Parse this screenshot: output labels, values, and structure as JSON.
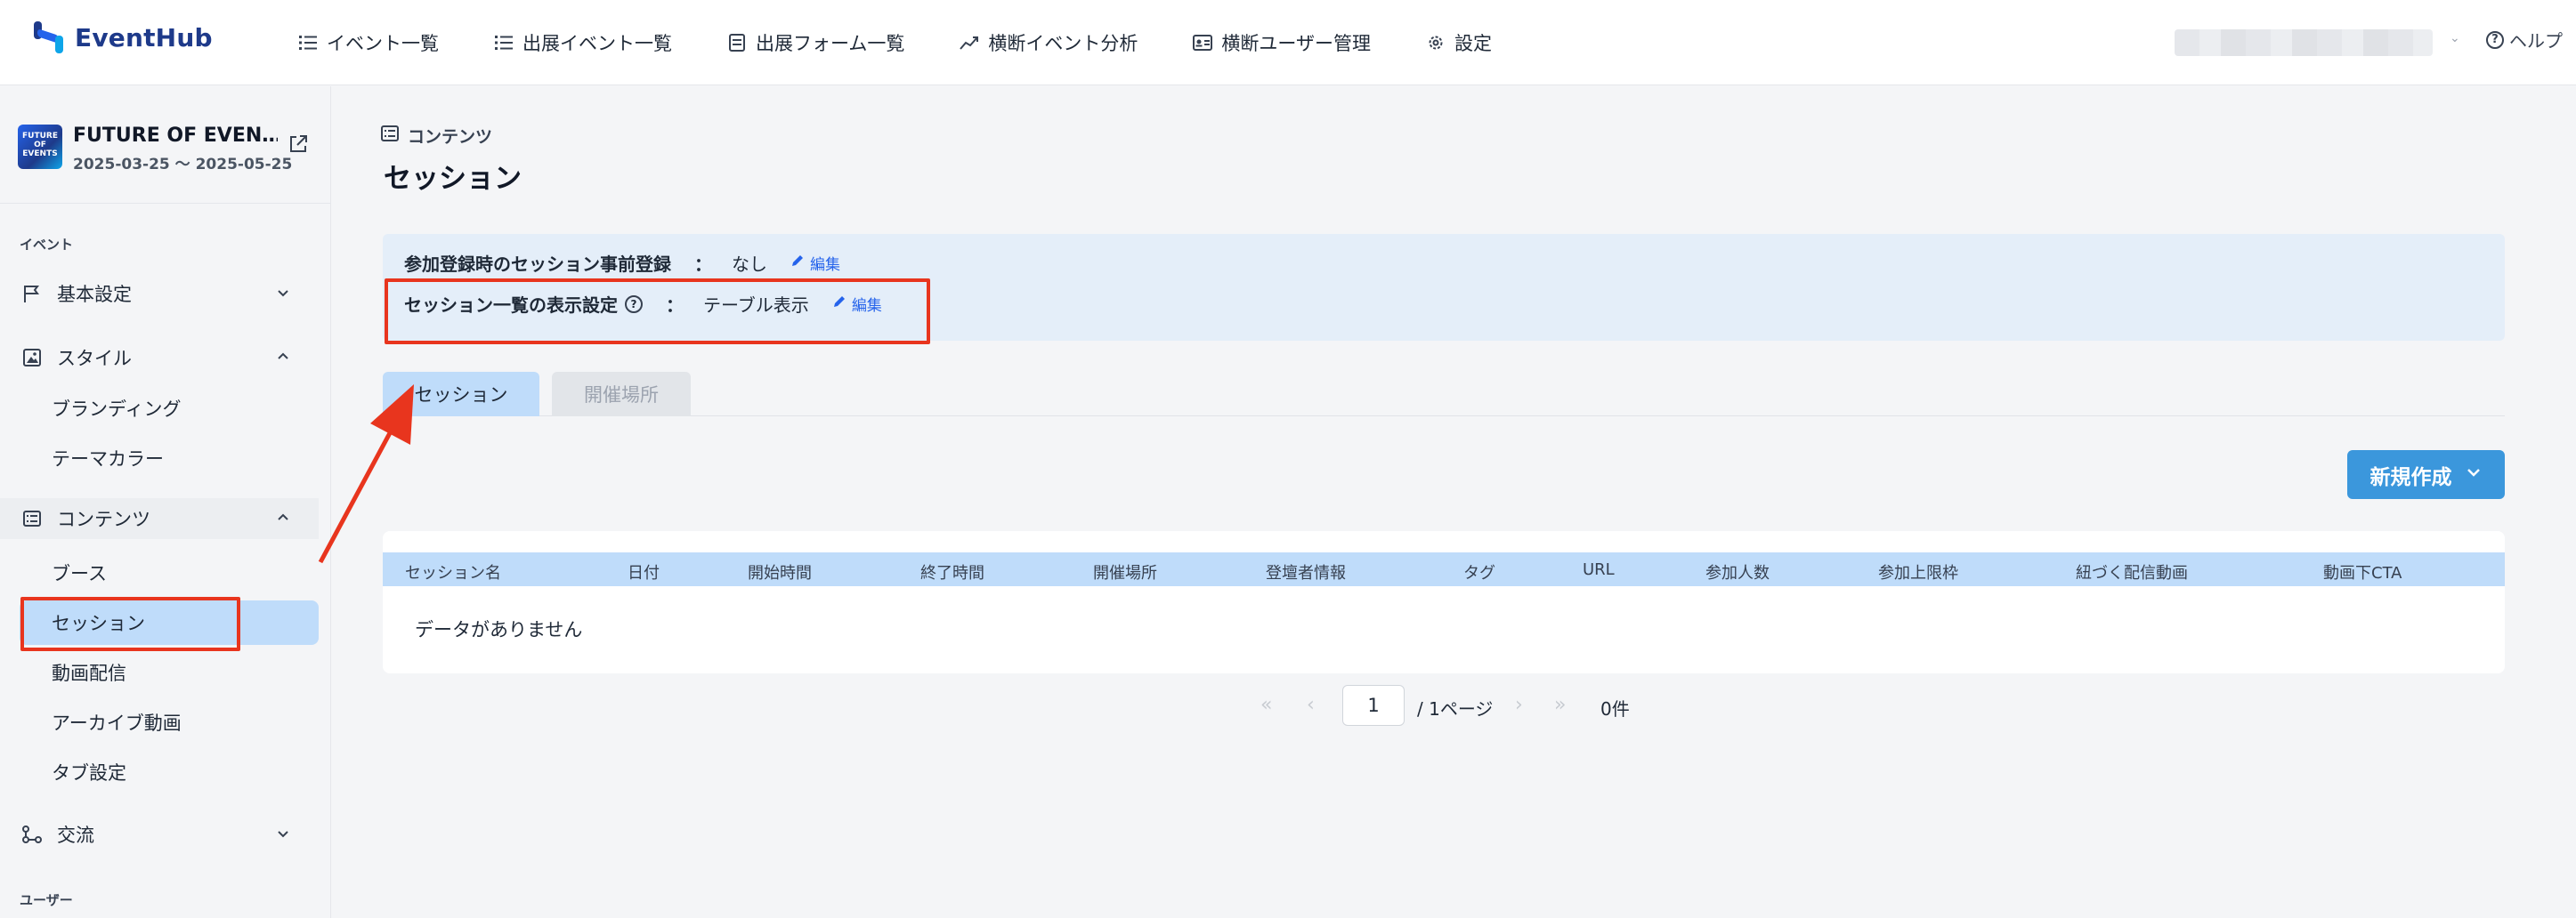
{
  "app": {
    "logo_text": "EventHub"
  },
  "topnav": {
    "items": [
      {
        "label": "イベント一覧",
        "icon": "list-icon"
      },
      {
        "label": "出展イベント一覧",
        "icon": "list-icon"
      },
      {
        "label": "出展フォーム一覧",
        "icon": "form-icon"
      },
      {
        "label": "横断イベント分析",
        "icon": "chart-icon"
      },
      {
        "label": "横断ユーザー管理",
        "icon": "id-card-icon"
      },
      {
        "label": "設定",
        "icon": "gear-icon"
      }
    ],
    "help_label": "ヘルプ"
  },
  "sidebar": {
    "event": {
      "name": "FUTURE OF EVEN…",
      "dates": "2025-03-25 〜 2025-05-25",
      "thumb_text": "FUTURE OF EVENTS"
    },
    "section_event": "イベント",
    "groups": [
      {
        "label": "基本設定",
        "icon": "flag-icon",
        "expanded": false
      },
      {
        "label": "スタイル",
        "icon": "image-icon",
        "expanded": true,
        "children": [
          "ブランディング",
          "テーマカラー"
        ]
      },
      {
        "label": "コンテンツ",
        "icon": "list-box-icon",
        "expanded": true,
        "children": [
          "ブース",
          "セッション",
          "動画配信",
          "アーカイブ動画",
          "タブ設定"
        ]
      },
      {
        "label": "交流",
        "icon": "network-icon",
        "expanded": false
      }
    ],
    "active_child": "セッション",
    "section_user": "ユーザー"
  },
  "main": {
    "breadcrumb": "コンテンツ",
    "title": "セッション",
    "info": {
      "row1": {
        "label": "参加登録時のセッション事前登録",
        "sep": "：",
        "value": "なし",
        "edit": "編集"
      },
      "row2": {
        "label": "セッション一覧の表示設定",
        "sep": "：",
        "value": "テーブル表示",
        "edit": "編集"
      }
    },
    "tabs": [
      {
        "label": "セッション",
        "active": true
      },
      {
        "label": "開催場所",
        "active": false
      }
    ],
    "new_button": "新規作成",
    "table": {
      "columns": [
        "セッション名",
        "日付",
        "開始時間",
        "終了時間",
        "開催場所",
        "登壇者情報",
        "タグ",
        "URL",
        "参加人数",
        "参加上限枠",
        "紐づく配信動画",
        "動画下CTA"
      ],
      "empty_text": "データがありません"
    },
    "pager": {
      "current_page": "1",
      "page_text": "/ 1ページ",
      "count_text": "0件"
    }
  },
  "colors": {
    "accent": "#3b97dc",
    "highlight": "#bfdcfa",
    "annotation_red": "#e8351e",
    "brand": "#1e3a8a"
  }
}
